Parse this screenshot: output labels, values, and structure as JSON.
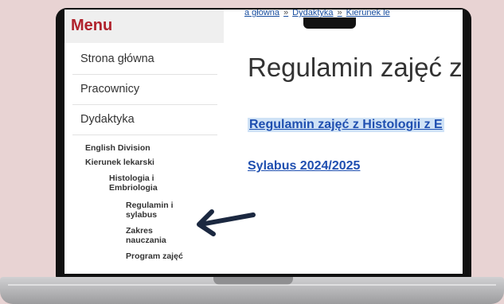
{
  "sidebar": {
    "heading": "Menu",
    "items": [
      {
        "label": "Strona główna"
      },
      {
        "label": "Pracownicy"
      },
      {
        "label": "Dydaktyka"
      }
    ],
    "sub_items": [
      {
        "label": "English Division"
      },
      {
        "label": "Kierunek lekarski"
      }
    ],
    "sub_sub": {
      "label": "Histologia i Embriologia"
    },
    "leaf_items": [
      {
        "label": "Regulamin i sylabus"
      },
      {
        "label": "Zakres nauczania"
      },
      {
        "label": "Program zajęć"
      }
    ]
  },
  "breadcrumb": {
    "items": [
      "a główna",
      "Dydaktyka",
      "Kierunek le"
    ],
    "separator": "»"
  },
  "main": {
    "title": "Regulamin zajęć z H",
    "link_regulamin": "Regulamin zajęć z Histologii z E",
    "link_sylabus": "Sylabus 2024/2025"
  },
  "annotation": {
    "icon": "left-arrow-icon",
    "color": "#1b2840"
  },
  "colors": {
    "menu_heading": "#b0222c",
    "link": "#1f4fb0",
    "link_highlight": "#cfe2f6",
    "background": "#e8d3d3"
  }
}
